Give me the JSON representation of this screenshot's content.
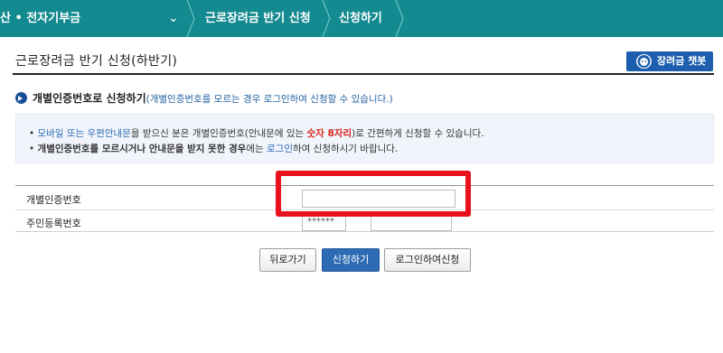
{
  "topnav": {
    "crumb_1": "산 • 전자기부금",
    "crumb_2": "근로장려금 반기 신청",
    "crumb_3": "신청하기",
    "dropdown_icon": "chevron-down-icon"
  },
  "page": {
    "title": "근로장려금 반기 신청(하반기)",
    "chatbot_button": "장려금 챗봇"
  },
  "section": {
    "heading": "개별인증번호로 신청하기",
    "heading_note": "(개별인증번호를 모르는 경우 로그인하여 신청할 수 있습니다.)"
  },
  "info": {
    "line1_bullet": "•",
    "line1_part1": "모바일 또는 우편안내문",
    "line1_part2": "을 받으신 분은 개별인증번호(안내문에 있는 ",
    "line1_part3": "숫자 8자리",
    "line1_part4": ")로 간편하게 신청할 수 있습니다.",
    "line2_bullet": "•",
    "line2_part1": "개별인증번호를 모르시거나 안내문을 받지 못한 경우",
    "line2_part2": "에는 ",
    "line2_part3": "로그인",
    "line2_part4": "하여 신청하시기 바랍니다."
  },
  "form": {
    "cert_label": "개별인증번호",
    "cert_value": "",
    "rrn_label": "주민등록번호",
    "rrn_front_value": "******",
    "rrn_dash": "–",
    "rrn_back_value": ""
  },
  "buttons": {
    "back": "뒤로가기",
    "apply": "신청하기",
    "login_apply": "로그인하여신청"
  },
  "colors": {
    "nav": "#138a8f",
    "primary": "#2d6bb4",
    "highlight": "#e8111d"
  }
}
